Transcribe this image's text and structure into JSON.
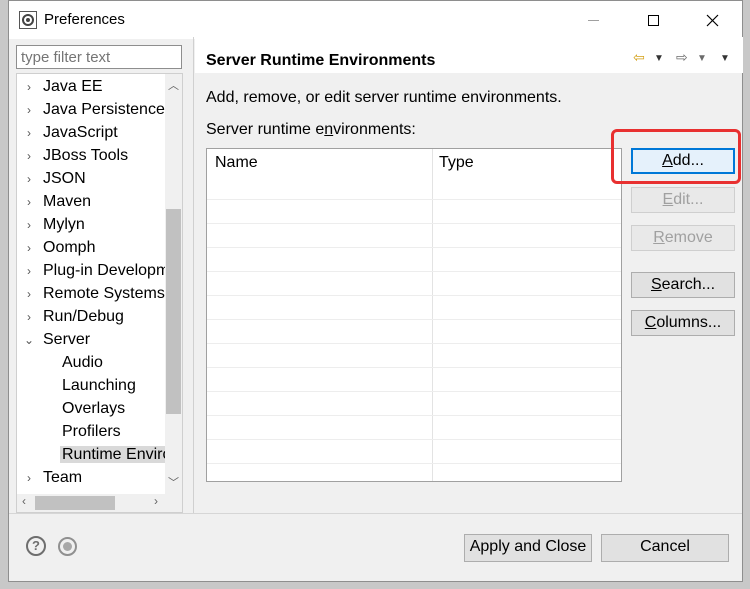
{
  "window": {
    "title": "Preferences"
  },
  "filter": {
    "placeholder": "type filter text"
  },
  "tree": {
    "items": [
      {
        "label": "Java EE",
        "chevron": "›"
      },
      {
        "label": "Java Persistence",
        "chevron": "›"
      },
      {
        "label": "JavaScript",
        "chevron": "›"
      },
      {
        "label": "JBoss Tools",
        "chevron": "›"
      },
      {
        "label": "JSON",
        "chevron": "›"
      },
      {
        "label": "Maven",
        "chevron": "›"
      },
      {
        "label": "Mylyn",
        "chevron": "›"
      },
      {
        "label": "Oomph",
        "chevron": "›"
      },
      {
        "label": "Plug-in Developm",
        "chevron": "›"
      },
      {
        "label": "Remote Systems",
        "chevron": "›"
      },
      {
        "label": "Run/Debug",
        "chevron": "›"
      },
      {
        "label": "Server",
        "chevron": "⌄"
      },
      {
        "label": "Audio",
        "chevron": ""
      },
      {
        "label": "Launching",
        "chevron": ""
      },
      {
        "label": "Overlays",
        "chevron": ""
      },
      {
        "label": "Profilers",
        "chevron": ""
      },
      {
        "label": "Runtime Enviro",
        "chevron": ""
      },
      {
        "label": "Team",
        "chevron": "›"
      }
    ]
  },
  "page": {
    "title": "Server Runtime Environments",
    "description": "Add, remove, or edit server runtime environments.",
    "list_label_pre": "Server runtime e",
    "list_label_mn": "n",
    "list_label_post": "vironments:",
    "table": {
      "col_name": "Name",
      "col_type": "Type"
    }
  },
  "buttons": {
    "add": {
      "mn": "A",
      "rest": "dd..."
    },
    "edit": {
      "mn": "E",
      "rest": "dit..."
    },
    "remove": {
      "mn": "R",
      "rest": "emove"
    },
    "search": {
      "mn": "S",
      "rest": "earch..."
    },
    "columns": {
      "mn": "C",
      "rest": "olumns..."
    },
    "apply_close": "Apply and Close",
    "cancel": "Cancel"
  },
  "colors": {
    "highlight": "#e83030",
    "accent": "#0078d7"
  }
}
